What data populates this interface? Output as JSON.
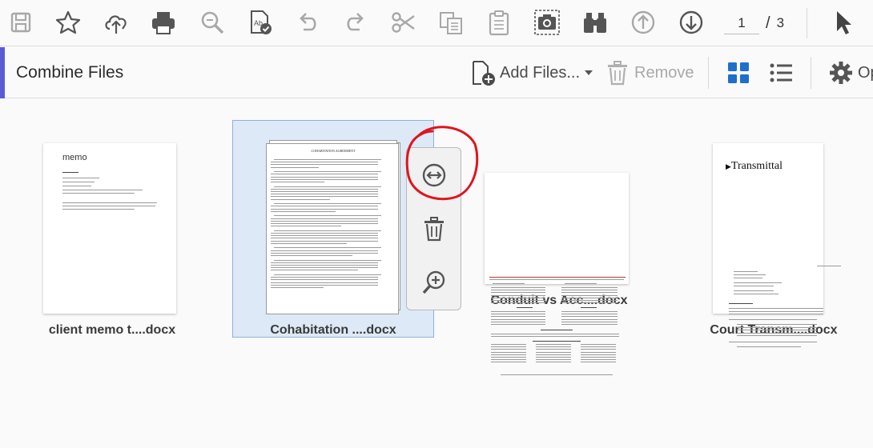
{
  "toolbar": {
    "icons": [
      "save-icon",
      "bookmark-star-icon",
      "cloud-upload-icon",
      "print-icon",
      "zoom-search-icon",
      "spellcheck-icon",
      "undo-icon",
      "redo-icon",
      "cut-icon",
      "copy-icon",
      "paste-icon",
      "snapshot-icon",
      "find-binoculars-icon",
      "page-up-icon",
      "page-down-icon",
      "select-cursor-icon"
    ],
    "page_current": "1",
    "page_separator": "/",
    "page_total": "3"
  },
  "header": {
    "title": "Combine Files",
    "add_files_label": "Add Files...",
    "remove_label": "Remove",
    "options_label": "Op"
  },
  "files": [
    {
      "name": "client memo t....docx",
      "thumb_heading": "memo"
    },
    {
      "name": "Cohabitation ....docx",
      "thumb_heading": "COHABITATION AGREEMENT"
    },
    {
      "name": "Conduit vs Acc....docx",
      "thumb_heading": ""
    },
    {
      "name": "Court Transm....docx",
      "thumb_heading": "Transmittal"
    }
  ],
  "colors": {
    "accent": "#5b5bd6",
    "selection": "#dde9f6",
    "annotation_red": "#e0141e",
    "grid_view_blue": "#1f6fc9"
  }
}
